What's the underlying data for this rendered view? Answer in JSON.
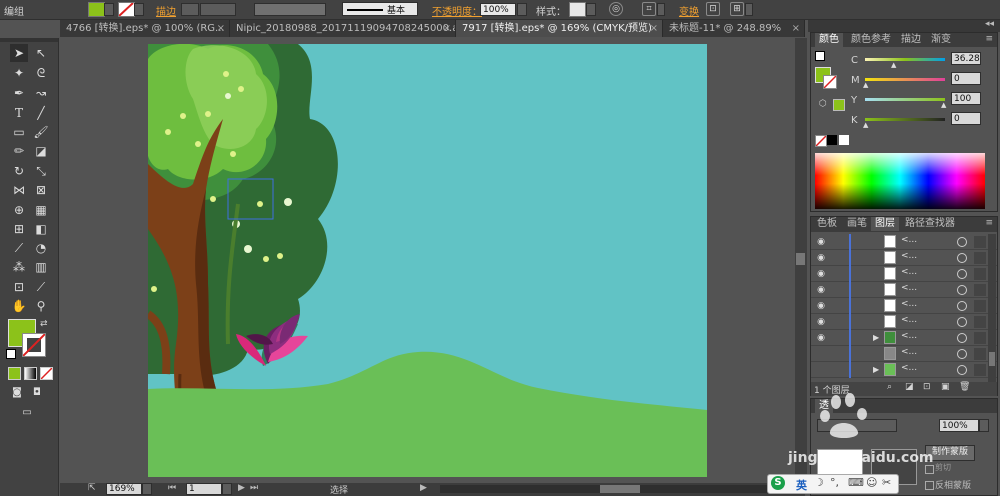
{
  "control_bar": {
    "selection_label": "编组",
    "stroke_label": "描边",
    "stroke_style": "基本",
    "opacity_label": "不透明度：",
    "opacity_value": "100%",
    "style_label": "样式：",
    "transform_label": "变换",
    "fill_color": "#8cc21a"
  },
  "tabs": [
    {
      "label": "4766 [转换].eps* @ 100% (RG...",
      "close": "×"
    },
    {
      "label": "Nipic_20180988_20171119094708245000.ai*",
      "close": "×"
    },
    {
      "label": "7917 [转换].eps* @ 169% (CMYK/预览)",
      "close": "×"
    },
    {
      "label": "未标题-11* @ 248.89%",
      "close": "×"
    }
  ],
  "tools": [
    "selection-tool",
    "direct-selection-tool",
    "magic-wand-tool",
    "lasso-tool",
    "pen-tool",
    "curvature-tool",
    "type-tool",
    "line-tool",
    "rectangle-tool",
    "paintbrush-tool",
    "pencil-tool",
    "eraser-tool",
    "rotate-tool",
    "scale-tool",
    "width-tool",
    "free-transform-tool",
    "shape-builder-tool",
    "perspective-grid-tool",
    "mesh-tool",
    "gradient-tool",
    "eyedropper-tool",
    "blend-tool",
    "symbol-sprayer-tool",
    "column-graph-tool",
    "artboard-tool",
    "slice-tool",
    "hand-tool",
    "zoom-tool"
  ],
  "color_panel": {
    "tabs": [
      "颜色",
      "颜色参考",
      "描边",
      "渐变"
    ],
    "channels": [
      {
        "label": "C",
        "value": "36.28",
        "color": "#8cc21a"
      },
      {
        "label": "M",
        "value": "0",
        "color": "#e0409a"
      },
      {
        "label": "Y",
        "value": "100",
        "color": "#f2e40e"
      },
      {
        "label": "K",
        "value": "0",
        "color": "#222222"
      }
    ]
  },
  "layers_panel": {
    "tabs": [
      "色板",
      "画笔",
      "图层",
      "路径查找器"
    ],
    "rows": [
      {
        "name": "<..."
      },
      {
        "name": "<..."
      },
      {
        "name": "<..."
      },
      {
        "name": "<..."
      },
      {
        "name": "<..."
      },
      {
        "name": "<..."
      },
      {
        "name": "<..."
      },
      {
        "name": "<..."
      },
      {
        "name": "<..."
      }
    ],
    "layer_count": "1 个图层"
  },
  "transparency_panel": {
    "tab": "透",
    "value": "100%",
    "make_mask_button": "制作蒙版",
    "clip_label": "剪切",
    "invert_mask_label": "反相蒙版"
  },
  "status_bar": {
    "zoom": "169%",
    "artboard": "1",
    "tool_status": "选择"
  },
  "watermark": {
    "text": "jingyan.baidu.com",
    "ime_label": "英"
  }
}
